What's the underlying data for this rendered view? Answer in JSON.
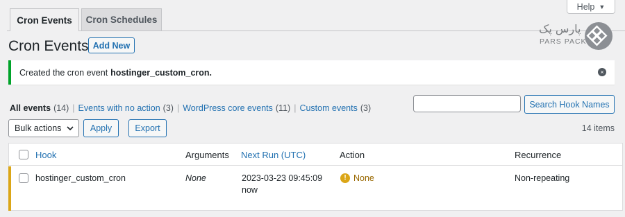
{
  "tabs": [
    {
      "label": "Cron Events",
      "active": true
    },
    {
      "label": "Cron Schedules",
      "active": false
    }
  ],
  "help": {
    "label": "Help",
    "caret": "▼"
  },
  "logo": {
    "text_fa": "پارس پک",
    "text_en": "PARS PACK"
  },
  "header": {
    "title": "Cron Events",
    "add_new": "Add New"
  },
  "notice": {
    "text": "Created the cron event",
    "event_name": "hostinger_custom_cron.",
    "close_icon": "×"
  },
  "filters": [
    {
      "label": "All events",
      "count": "(14)"
    },
    {
      "label": "Events with no action",
      "count": "(3)"
    },
    {
      "label": "WordPress core events",
      "count": "(11)"
    },
    {
      "label": "Custom events",
      "count": "(3)"
    }
  ],
  "search": {
    "button": "Search Hook Names",
    "placeholder": ""
  },
  "bulk": {
    "label": "Bulk actions",
    "apply": "Apply",
    "export": "Export"
  },
  "items_count": "14 items",
  "table": {
    "columns": [
      "Hook",
      "Arguments",
      "Next Run (UTC)",
      "Action",
      "Recurrence"
    ],
    "rows": [
      {
        "hook": "hostinger_custom_cron",
        "arguments": "None",
        "next_run_line1": "2023-03-23 09:45:09",
        "next_run_line2": "now",
        "action": "None",
        "recurrence": "Non-repeating"
      }
    ]
  },
  "colors": {
    "accent": "#2271b1",
    "success": "#00a32a",
    "warning": "#dba617",
    "background": "#f0f0f1"
  }
}
